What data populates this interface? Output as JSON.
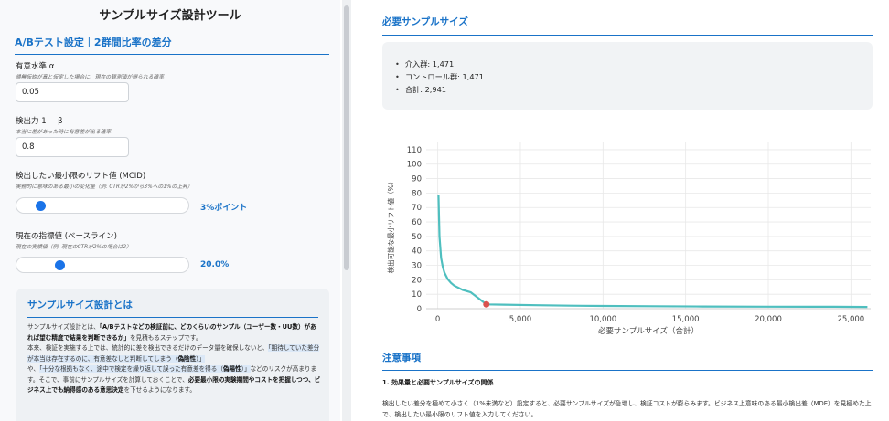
{
  "app": {
    "title": "サンプルサイズ設計ツール"
  },
  "settings": {
    "section_title": "A/Bテスト設定｜2群間比率の差分",
    "alpha": {
      "label": "有意水準 α",
      "desc": "帰無仮説が真と仮定した場合に、現在の観測値が得られる確率",
      "value": "0.05"
    },
    "power": {
      "label": "検出力 1 − β",
      "desc": "本当に差があった時に有意差が出る確率",
      "value": "0.8"
    },
    "mcid": {
      "label": "検出したい最小限のリフト値 (MCID)",
      "desc": "実務的に意味のある最小の変化量（例: CTRが2%から3%への1%の上昇）",
      "value_text": "3%ポイント",
      "slider_fraction": 0.1
    },
    "baseline": {
      "label": "現在の指標値 (ベースライン)",
      "desc": "現在の実績値（例: 現在のCTRが2%の場合は2）",
      "value_text": "20.0%",
      "slider_fraction": 0.22
    }
  },
  "info": {
    "title": "サンプルサイズ設計とは",
    "p1_a": "サンプルサイズ設計とは、",
    "p1_b": "「A/Bテストなどの検証前に、どのくらいのサンプル（ユーザー数・UU数）があれば望む精度で結果を判断できるか」",
    "p1_c": "を見積もるステップです。",
    "p2_a": "本来、検証を実施する上では、統計的に差を検出できるだけのデータ量を確保しないと、",
    "p2_b": "「期待していた差分が本当は存在するのに、有意差なしと判断してしまう（",
    "p2_c": "偽陰性",
    "p2_d": "）」",
    "p2_e": "や、",
    "p2_f": "「十分な根拠もなく、途中で検定を繰り返して誤った有意差を得る（",
    "p2_g": "偽陽性",
    "p2_h": "）」",
    "p2_i": "などのリスクが高まります。そこで、事前にサンプルサイズを計算しておくことで、",
    "p2_j": "必要最小限の実験期間やコストを把握しつつ、ビジネス上でも納得感のある意思決定",
    "p2_k": "を下せるようになります。"
  },
  "results": {
    "title": "必要サンプルサイズ",
    "items": [
      "介入群: 1,471",
      "コントロール群: 1,471",
      "合計: 2,941"
    ]
  },
  "chart_data": {
    "type": "line",
    "xlabel": "必要サンプルサイズ（合計）",
    "ylabel": "検出可能な最小リフト値（%）",
    "xlim": [
      -700,
      26200
    ],
    "ylim": [
      0,
      115
    ],
    "xticks": [
      0,
      5000,
      10000,
      15000,
      20000,
      25000
    ],
    "xtick_labels": [
      "0",
      "5,000",
      "10,000",
      "15,000",
      "20,000",
      "25,000"
    ],
    "yticks": [
      0,
      10,
      20,
      30,
      40,
      50,
      60,
      70,
      80,
      90,
      100,
      110
    ],
    "grid": true,
    "series": [
      {
        "color": "#4fbfbf",
        "x": [
          40,
          100,
          200,
          300,
          400,
          600,
          800,
          1000,
          1500,
          2000,
          2941,
          4000,
          6000,
          8000,
          10000,
          13000,
          16000,
          20000,
          24000,
          26000
        ],
        "y": [
          79,
          50,
          35,
          29,
          25,
          20.5,
          17.8,
          15.9,
          13,
          11.3,
          3,
          2.8,
          2.4,
          2.1,
          1.9,
          1.7,
          1.5,
          1.4,
          1.3,
          1.2
        ]
      }
    ],
    "marker": {
      "x": 2941,
      "y": 3,
      "color": "#d9534f"
    }
  },
  "notes": {
    "title": "注意事項",
    "sub": "1. 効果量と必要サンプルサイズの関係",
    "body": "検出したい差分を極めて小さく（1%未満など）設定すると、必要サンプルサイズが急増し、検証コストが膨らみます。ビジネス上意味のある最小検出差（MDE）を見極めた上で、検出したい最小限のリフト値を入力してください。"
  }
}
